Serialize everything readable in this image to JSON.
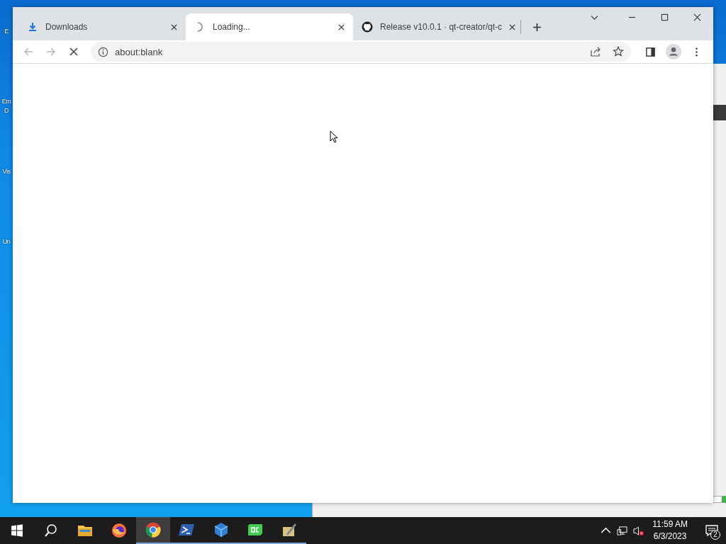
{
  "desktop_icons": [
    {
      "lines": [
        "E"
      ]
    },
    {
      "lines": [
        "Em",
        "D"
      ]
    },
    {
      "lines": [
        "Vis"
      ]
    },
    {
      "lines": [
        "Un"
      ]
    }
  ],
  "browser": {
    "tabs": [
      {
        "kind": "download",
        "title": "Downloads",
        "selected": false
      },
      {
        "kind": "loading",
        "title": "Loading...",
        "selected": true
      },
      {
        "kind": "github",
        "title": "Release v10.0.1 · qt-creator/qt-c",
        "selected": false
      }
    ],
    "address": "about:blank",
    "loading": true
  },
  "taskbar": {
    "apps": [
      {
        "kind": "explorer",
        "running": false,
        "selected": false
      },
      {
        "kind": "firefox",
        "running": false,
        "selected": false
      },
      {
        "kind": "chrome",
        "running": true,
        "selected": true
      },
      {
        "kind": "powershell",
        "running": true,
        "selected": false
      },
      {
        "kind": "cube",
        "running": true,
        "selected": false
      },
      {
        "kind": "qc",
        "running": true,
        "selected": false
      },
      {
        "kind": "tool",
        "running": true,
        "selected": false
      }
    ],
    "time": "11:59 AM",
    "date": "6/3/2023",
    "notifications": "2"
  }
}
